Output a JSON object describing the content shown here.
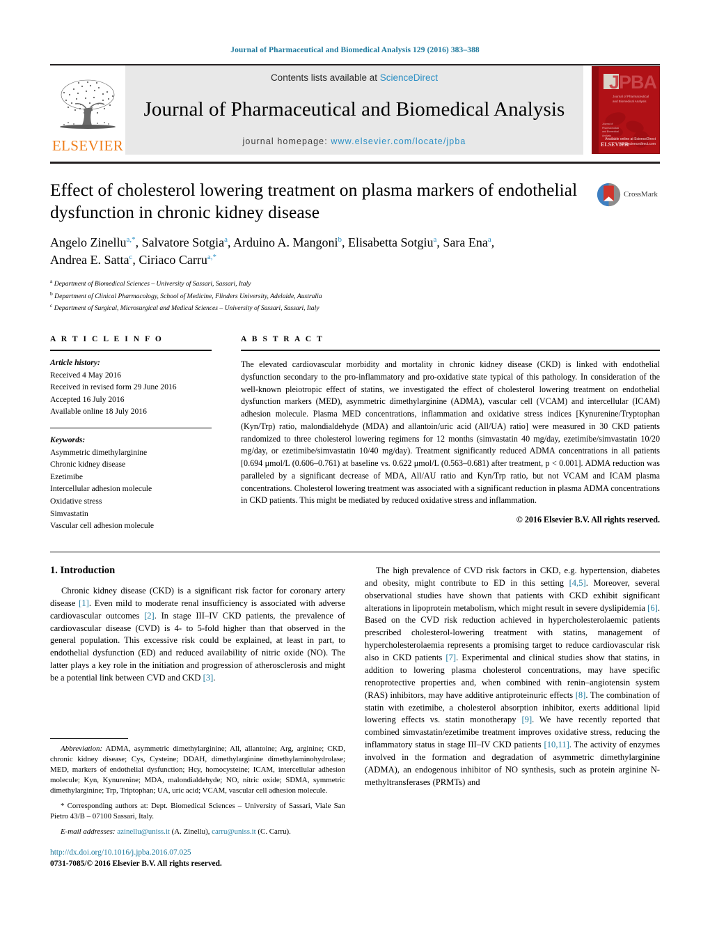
{
  "running_head": "Journal of Pharmaceutical and Biomedical Analysis 129 (2016) 383–388",
  "masthead": {
    "contents_prefix": "Contents lists available at ",
    "sciencedirect": "ScienceDirect",
    "journal_title": "Journal of Pharmaceutical and Biomedical Analysis",
    "homepage_prefix": "journal homepage: ",
    "homepage_url": "www.elsevier.com/locate/jpba",
    "publisher": "ELSEVIER",
    "cover": {
      "acronym": "JPBA",
      "subtitle": "Journal of Pharmaceutical and Biomedical Analysis",
      "side_label": "Journal of Pharmaceutical and Biomedical Analysis",
      "publisher_mark": "ELSEVIER",
      "sciencedirect_mark": "Available online at ScienceDirect www.sciencedirect.com"
    }
  },
  "title": "Effect of cholesterol lowering treatment on plasma markers of endothelial dysfunction in chronic kidney disease",
  "crossmark_label": "CrossMark",
  "authors_line1": "Angelo Zinellu<sup>a,</sup><sup>*</sup>, Salvatore Sotgia<sup>a</sup>, Arduino A. Mangoni<sup>b</sup>, Elisabetta Sotgiu<sup>a</sup>, Sara Ena<sup>a</sup>,",
  "authors_line2": "Andrea E. Satta<sup>c</sup>, Ciriaco Carru<sup>a,</sup><sup>*</sup>",
  "affiliations": [
    "<sup>a</sup> Department of Biomedical Sciences &#8211; University of Sassari, Sassari, Italy",
    "<sup>b</sup> Department of Clinical Pharmacology, School of Medicine, Flinders University, Adelaide, Australia",
    "<sup>c</sup> Department of Surgical, Microsurgical and Medical Sciences &#8211; University of Sassari, Sassari, Italy"
  ],
  "article_info": {
    "heading": "A R T I C L E  I N F O",
    "history_label": "Article history:",
    "history": [
      "Received 4 May 2016",
      "Received in revised form 29 June 2016",
      "Accepted 16 July 2016",
      "Available online 18 July 2016"
    ],
    "keywords_label": "Keywords:",
    "keywords": [
      "Asymmetric dimethylarginine",
      "Chronic kidney disease",
      "Ezetimibe",
      "Intercellular adhesion molecule",
      "Oxidative stress",
      "Simvastatin",
      "Vascular cell adhesion molecule"
    ]
  },
  "abstract": {
    "heading": "A B S T R A C T",
    "text": "The elevated cardiovascular morbidity and mortality in chronic kidney disease (CKD) is linked with endothelial dysfunction secondary to the pro-inflammatory and pro-oxidative state typical of this pathology. In consideration of the well-known pleiotropic effect of statins, we investigated the effect of cholesterol lowering treatment on endothelial dysfunction markers (MED), asymmetric dimethylarginine (ADMA), vascular cell (VCAM) and intercellular (ICAM) adhesion molecule. Plasma MED concentrations, inflammation and oxidative stress indices [Kynurenine/Tryptophan (Kyn/Trp) ratio, malondialdehyde (MDA) and allantoin/uric acid (All/UA) ratio] were measured in 30 CKD patients randomized to three cholesterol lowering regimens for 12 months (simvastatin 40 mg/day, ezetimibe/simvastatin 10/20 mg/day, or ezetimibe/simvastatin 10/40 mg/day). Treatment significantly reduced ADMA concentrations in all patients [0.694 μmol/L (0.606–0.761) at baseline vs. 0.622 μmol/L (0.563–0.681) after treatment, p < 0.001]. ADMA reduction was paralleled by a significant decrease of MDA, All/AU ratio and Kyn/Trp ratio, but not VCAM and ICAM plasma concentrations. Cholesterol lowering treatment was associated with a significant reduction in plasma ADMA concentrations in CKD patients. This might be mediated by reduced oxidative stress and inflammation.",
    "copyright": "© 2016 Elsevier B.V. All rights reserved."
  },
  "introduction": {
    "heading": "1.  Introduction",
    "left_paragraph": "Chronic kidney disease (CKD) is a significant risk factor for coronary artery disease <span class=\"ref\">[1]</span>. Even mild to moderate renal insufficiency is associated with adverse cardiovascular outcomes <span class=\"ref\">[2]</span>. In stage III–IV CKD patients, the prevalence of cardiovascular disease (CVD) is 4- to 5-fold higher than that observed in the general population. This excessive risk could be explained, at least in part, to endothelial dysfunction (ED) and reduced availability of nitric oxide (NO). The latter plays a key role in the initiation and progression of atherosclerosis and might be a potential link between CVD and CKD <span class=\"ref\">[3]</span>.",
    "right_paragraph": "The high prevalence of CVD risk factors in CKD, e.g. hypertension, diabetes and obesity, might contribute to ED in this setting <span class=\"ref\">[4,5]</span>. Moreover, several observational studies have shown that patients with CKD exhibit significant alterations in lipoprotein metabolism, which might result in severe dyslipidemia <span class=\"ref\">[6]</span>. Based on the CVD risk reduction achieved in hypercholesterolaemic patients prescribed cholesterol-lowering treatment with statins, management of hypercholesterolaemia represents a promising target to reduce cardiovascular risk also in CKD patients <span class=\"ref\">[7]</span>. Experimental and clinical studies show that statins, in addition to lowering plasma cholesterol concentrations, may have specific renoprotective properties and, when combined with renin–angiotensin system (RAS) inhibitors, may have additive antiproteinuric effects <span class=\"ref\">[8]</span>. The combination of statin with ezetimibe, a cholesterol absorption inhibitor, exerts additional lipid lowering effects vs. statin monotherapy <span class=\"ref\">[9]</span>. We have recently reported that combined simvastatin/ezetimibe treatment improves oxidative stress, reducing the inflammatory status in stage III–IV CKD patients <span class=\"ref\">[10,11]</span>. The activity of enzymes involved in the formation and degradation of asymmetric dimethylarginine (ADMA), an endogenous inhibitor of NO synthesis, such as protein arginine N-methyltransferases (PRMTs) and"
  },
  "footnotes": {
    "abbreviation": "<em>Abbreviation:</em>  ADMA, asymmetric dimethylarginine; All, allantoine; Arg, arginine; CKD, chronic kidney disease; Cys, Cysteine; DDAH, dimethylarginine dimethylaminohydrolase; MED, markers of endothelial dysfunction; Hcy, homocysteine; ICAM, intercellular adhesion molecule; Kyn, Kynurenine; MDA, malondialdehyde; NO, nitric oxide; SDMA, symmetric dimethylarginine; Trp, Triptophan; UA, uric acid; VCAM, vascular cell adhesion molecule.",
    "corresponding": "* Corresponding authors at: Dept. Biomedical Sciences &#8211; University of Sassari, Viale San Pietro 43/B &#8211; 07100 Sassari, Italy.",
    "emails": "<em>E-mail addresses:</em> <span class=\"link\">azinellu@uniss.it</span> (A. Zinellu), <span class=\"link\">carru@uniss.it</span> (C. Carru)."
  },
  "doi": "http://dx.doi.org/10.1016/j.jpba.2016.07.025",
  "issn_line": "0731-7085/© 2016 Elsevier B.V. All rights reserved."
}
